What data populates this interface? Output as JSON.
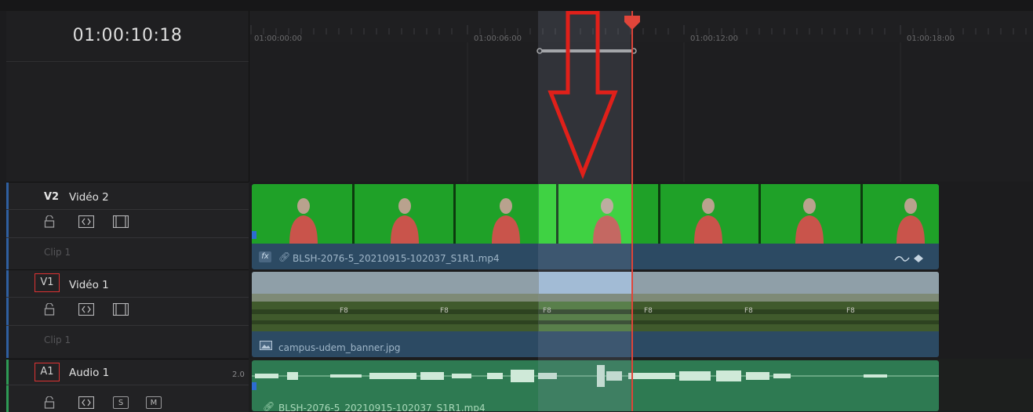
{
  "timecode": "01:00:10:18",
  "ruler": {
    "ticks": [
      "01:00:00:00",
      "01:00:06:00",
      "01:00:12:00",
      "01:00:18:00"
    ]
  },
  "tracks": {
    "v2": {
      "code": "V2",
      "name": "Vidéo 2",
      "clip_count": "Clip 1",
      "clip_name": "BLSH-2076-5_20210915-102037_S1R1.mp4",
      "fx_badge": "fx"
    },
    "v1": {
      "code": "V1",
      "name": "Vidéo 1",
      "clip_count": "Clip 1",
      "clip_name": "campus-udem_banner.jpg"
    },
    "a1": {
      "code": "A1",
      "name": "Audio 1",
      "channels": "2.0",
      "clip_name": "BLSH-2076-5_20210915-102037_S1R1.mp4",
      "solo_label": "S",
      "mute_label": "M"
    }
  },
  "colors": {
    "playhead": "#e0453a",
    "green_clip": "#22a526",
    "video_clip_bar": "#2c4a63",
    "audio_clip": "#2e7a52",
    "annotation_arrow": "#e0201a"
  }
}
